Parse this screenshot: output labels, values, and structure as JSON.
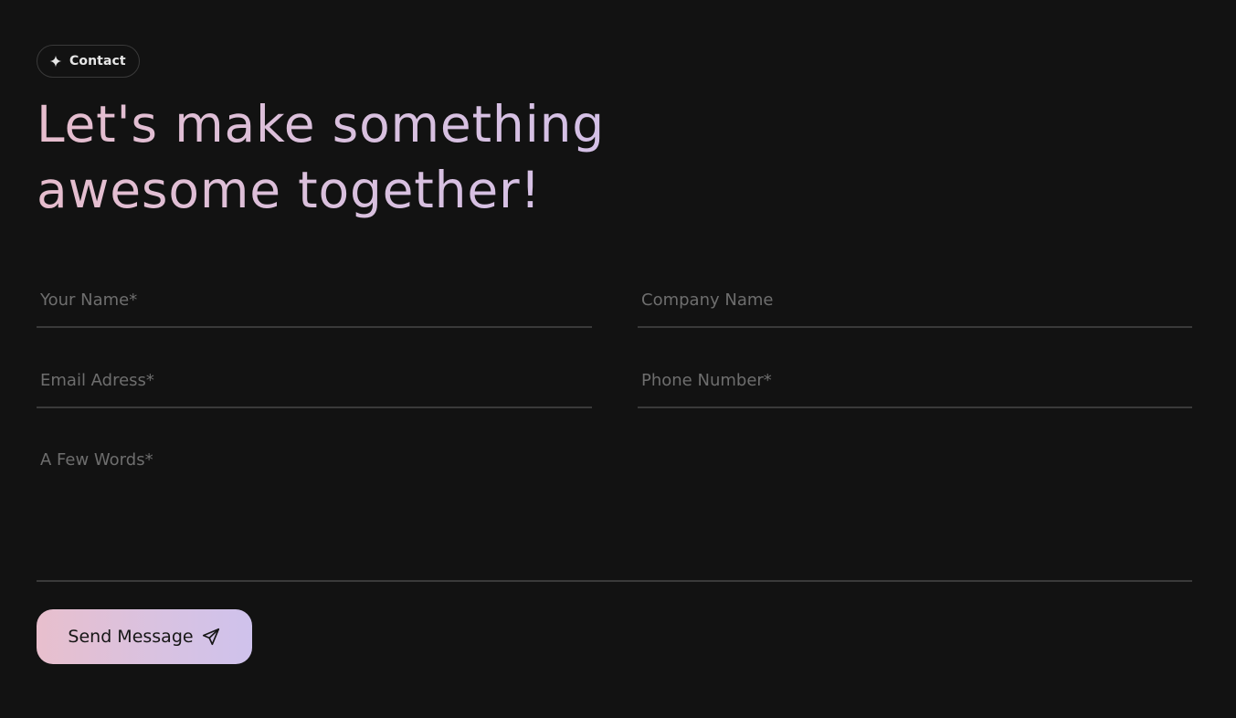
{
  "badge": {
    "icon": "sparkle-icon",
    "label": "Contact"
  },
  "headline": {
    "line1": "Let's make something",
    "line2": "awesome together!",
    "gradient_colors": [
      "#e6bdcd",
      "#d2c0ea"
    ]
  },
  "form": {
    "name_placeholder": "Your Name*",
    "company_placeholder": "Company Name",
    "email_placeholder": "Email Adress*",
    "phone_placeholder": "Phone Number*",
    "words_placeholder": "A Few Words*"
  },
  "send_button": {
    "label": "Send Message",
    "icon": "paper-plane-icon"
  },
  "colors": {
    "background": "#121212",
    "field_border": "#3a3a3a",
    "placeholder": "#6e6e6e"
  }
}
